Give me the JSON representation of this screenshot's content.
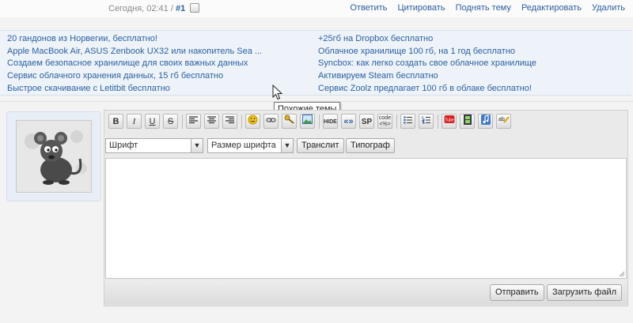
{
  "post": {
    "meta_date": "Сегодня, 02:41 / ",
    "meta_num": "#1",
    "actions": [
      "Ответить",
      "Цитировать",
      "Поднять тему",
      "Редактировать",
      "Удалить"
    ]
  },
  "similar_topics": {
    "left": [
      "20 гандонов из Норвегии, бесплатно!",
      "Apple MacBook Air, ASUS Zenbook UX32 или накопитель Sea ...",
      "Создаем безопасное хранилище для своих важных данных",
      "Сервис облачного хранения данных, 15 гб бесплатно",
      "Быстрое скачивание с Letitbit бесплатно"
    ],
    "right": [
      "+25гб на Dropbox бесплатно",
      "Облачное хранилище 100 гб, на 1 год бесплатно",
      "Syncbox: как легко создать свое облачное хранилище",
      "Активируем Steam бесплатно",
      "Сервис Zoolz предлагает 100 гб в облаке бесплатно!"
    ],
    "tooltip": "Похожие темы"
  },
  "toolbar": {
    "bold": "B",
    "italic": "I",
    "underline": "U",
    "strike": "S",
    "hide": "HIDE",
    "quote": "«»",
    "spoiler": "SP",
    "code_top": "code",
    "code_bottom": "<%>",
    "font_select": "Шрифт",
    "size_select": "Размер шрифта",
    "translit": "Транслит",
    "typograph": "Типограф"
  },
  "editor_footer": {
    "send": "Отправить",
    "upload": "Загрузить файл"
  },
  "colors": {
    "link": "#2a5fa0",
    "similar_bg": "#eef3f9",
    "editor_bg": "#eaeaea"
  }
}
